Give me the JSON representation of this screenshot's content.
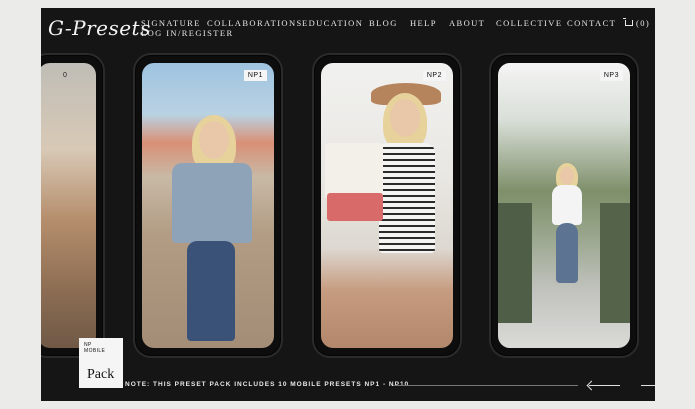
{
  "brand": {
    "logo_text": "G-Presets"
  },
  "nav": {
    "items": [
      "Signature",
      "Collaborations",
      "Education",
      "Blog",
      "Help",
      "About",
      "Collective",
      "Contact"
    ],
    "cart_count": "(0)",
    "cart_suffix": "I",
    "login": "Log in/Register"
  },
  "phones": [
    {
      "tag": "0"
    },
    {
      "tag": "NP1"
    },
    {
      "tag": "NP2"
    },
    {
      "tag": "NP3"
    }
  ],
  "pack": {
    "small_line1": "NP",
    "small_line2": "Mobile",
    "label": "Pack"
  },
  "note": {
    "text": "Note: This preset pack includes 10 mobile presets NP1 - NP10"
  },
  "colors": {
    "site_bg": "#151515",
    "page_bg": "#ebebea",
    "text": "#e8e8e8"
  }
}
